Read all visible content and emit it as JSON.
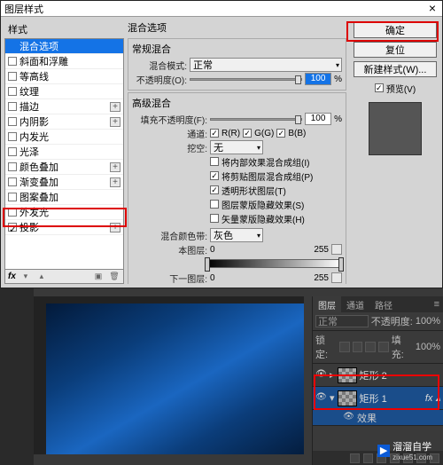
{
  "dialog": {
    "title": "图层样式",
    "styles_header": "样式",
    "items": [
      {
        "label": "混合选项",
        "has_checkbox": false,
        "selected": true,
        "has_plus": false
      },
      {
        "label": "斜面和浮雕",
        "has_checkbox": true,
        "has_plus": false
      },
      {
        "label": "等高线",
        "has_checkbox": true,
        "has_plus": false
      },
      {
        "label": "纹理",
        "has_checkbox": true,
        "has_plus": false
      },
      {
        "label": "描边",
        "has_checkbox": true,
        "has_plus": true
      },
      {
        "label": "内阴影",
        "has_checkbox": true,
        "has_plus": true
      },
      {
        "label": "内发光",
        "has_checkbox": true,
        "has_plus": false
      },
      {
        "label": "光泽",
        "has_checkbox": true,
        "has_plus": false
      },
      {
        "label": "颜色叠加",
        "has_checkbox": true,
        "has_plus": true
      },
      {
        "label": "渐变叠加",
        "has_checkbox": true,
        "has_plus": true
      },
      {
        "label": "图案叠加",
        "has_checkbox": true,
        "has_plus": false
      },
      {
        "label": "外发光",
        "has_checkbox": true,
        "has_plus": false
      },
      {
        "label": "投影",
        "has_checkbox": true,
        "checked": true,
        "has_plus": true
      }
    ]
  },
  "center": {
    "section_title": "混合选项",
    "general_title": "常规混合",
    "blend_mode_label": "混合模式:",
    "blend_mode_value": "正常",
    "opacity_label": "不透明度(O):",
    "opacity_value": "100",
    "pct": "%",
    "advanced_title": "高级混合",
    "fill_label": "填充不透明度(F):",
    "fill_value": "100",
    "channels_label": "通道:",
    "ch_r": "R(R)",
    "ch_g": "G(G)",
    "ch_b": "B(B)",
    "knockout_label": "挖空:",
    "knockout_value": "无",
    "opt1": "将内部效果混合成组(I)",
    "opt2": "将剪贴图层混合成组(P)",
    "opt3": "透明形状图层(T)",
    "opt4": "图层蒙版隐藏效果(S)",
    "opt5": "矢量蒙版隐藏效果(H)",
    "blendif_label": "混合颜色带:",
    "blendif_value": "灰色",
    "this_layer": "本图层:",
    "this_low": "0",
    "this_high": "255",
    "under_layer": "下一图层:",
    "under_low": "0",
    "under_high": "255"
  },
  "right": {
    "ok": "确定",
    "cancel": "复位",
    "new_style": "新建样式(W)...",
    "preview_label": "预览(V)"
  },
  "layers": {
    "tab1": "图层",
    "tab2": "通道",
    "tab3": "路径",
    "mode": "正常",
    "opacity_lbl": "不透明度:",
    "opacity": "100%",
    "lock_lbl": "锁定:",
    "fill_lbl": "填充:",
    "fill": "100%",
    "items": [
      {
        "name": "矩形 2"
      },
      {
        "name": "矩形 1",
        "selected": true,
        "fx": true
      }
    ],
    "effects_label": "效果"
  },
  "watermark": {
    "text": "溜溜自学",
    "domain": "zixue51.com"
  }
}
